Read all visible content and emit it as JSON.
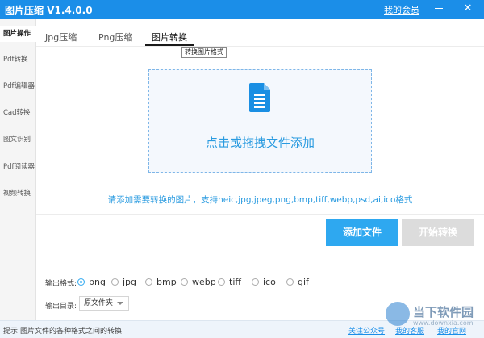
{
  "app": {
    "title": "图片压缩 V1.4.0.0",
    "member_link": "我的会员",
    "accent_color": "#1b8ee8"
  },
  "sidebar": {
    "items": [
      {
        "label": "图片操作",
        "active": true
      },
      {
        "label": "Pdf转换"
      },
      {
        "label": "Pdf编辑器"
      },
      {
        "label": "Cad转换"
      },
      {
        "label": "图文识别"
      },
      {
        "label": "Pdf阅读器"
      },
      {
        "label": "视频转换"
      }
    ]
  },
  "tabs": [
    {
      "label": "Jpg压缩"
    },
    {
      "label": "Png压缩"
    },
    {
      "label": "图片转换",
      "active": true
    }
  ],
  "tooltip": "转换图片格式",
  "dropzone": {
    "icon": "document-icon",
    "text": "点击或拖拽文件添加"
  },
  "hint": "请添加需要转换的图片，支持heic,jpg,jpeg,png,bmp,tiff,webp,psd,ai,ico格式",
  "buttons": {
    "add": "添加文件",
    "start": "开始转换"
  },
  "output": {
    "format_label": "输出格式:",
    "formats": [
      "png",
      "jpg",
      "bmp",
      "webp",
      "tiff",
      "ico",
      "gif"
    ],
    "selected_format": "png",
    "dir_label": "输出目录:",
    "dir_value": "原文件夹"
  },
  "statusbar": {
    "tip": "提示:图片文件的各种格式之间的转换",
    "links": [
      "关注公众号",
      "我的客服",
      "我的官网"
    ]
  },
  "watermark": {
    "text": "当下软件园",
    "url": "www.downxia.com"
  }
}
